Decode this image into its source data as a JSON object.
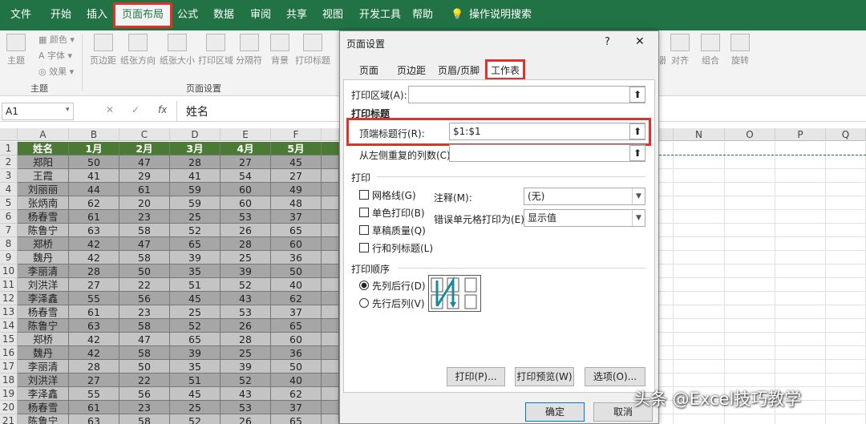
{
  "menu": [
    "文件",
    "开始",
    "插入",
    "页面布局",
    "公式",
    "数据",
    "审阅",
    "共享",
    "视图",
    "开发工具",
    "帮助",
    "操作说明搜索"
  ],
  "ribbon": {
    "theme_buttons": [
      "主题",
      "颜色",
      "字体",
      "效果"
    ],
    "pagesetup_buttons": [
      "页边距",
      "纸张方向",
      "纸张大小",
      "打印区域",
      "分隔符",
      "背景",
      "打印标题"
    ],
    "right_buttons": [
      "对齐",
      "组合",
      "旋转"
    ],
    "right_partial": "器",
    "group_labels": [
      "主题",
      "页面设置"
    ]
  },
  "namebox": "A1",
  "formula_value": "姓名",
  "fx": "fx",
  "columns": [
    "A",
    "B",
    "C",
    "D",
    "E",
    "F",
    "N",
    "O",
    "P",
    "Q"
  ],
  "rownums": [
    "1",
    "2",
    "3",
    "4",
    "5",
    "6",
    "7",
    "8",
    "9",
    "10",
    "11",
    "12",
    "13",
    "14",
    "15",
    "16",
    "17",
    "18",
    "19",
    "20",
    "21"
  ],
  "table": {
    "header": [
      "姓名",
      "1月",
      "2月",
      "3月",
      "4月",
      "5月"
    ],
    "rows": [
      [
        "郑阳",
        "50",
        "47",
        "28",
        "27",
        "45"
      ],
      [
        "王霞",
        "41",
        "29",
        "41",
        "54",
        "27"
      ],
      [
        "刘丽丽",
        "44",
        "61",
        "59",
        "60",
        "49"
      ],
      [
        "张炳南",
        "62",
        "20",
        "59",
        "60",
        "48"
      ],
      [
        "杨春雪",
        "61",
        "23",
        "25",
        "53",
        "37"
      ],
      [
        "陈鲁宁",
        "63",
        "58",
        "52",
        "26",
        "65"
      ],
      [
        "郑桥",
        "42",
        "47",
        "65",
        "28",
        "60"
      ],
      [
        "魏丹",
        "42",
        "58",
        "39",
        "25",
        "36"
      ],
      [
        "李丽清",
        "28",
        "50",
        "35",
        "39",
        "50"
      ],
      [
        "刘洪洋",
        "27",
        "22",
        "51",
        "52",
        "40"
      ],
      [
        "李泽鑫",
        "55",
        "56",
        "45",
        "43",
        "62"
      ],
      [
        "杨春雪",
        "61",
        "23",
        "25",
        "53",
        "37"
      ],
      [
        "陈鲁宁",
        "63",
        "58",
        "52",
        "26",
        "65"
      ],
      [
        "郑桥",
        "42",
        "47",
        "65",
        "28",
        "60"
      ],
      [
        "魏丹",
        "42",
        "58",
        "39",
        "25",
        "36"
      ],
      [
        "李丽清",
        "28",
        "50",
        "35",
        "39",
        "50"
      ],
      [
        "刘洪洋",
        "27",
        "22",
        "51",
        "52",
        "40"
      ],
      [
        "李泽鑫",
        "55",
        "56",
        "45",
        "43",
        "62"
      ],
      [
        "杨春雪",
        "61",
        "23",
        "25",
        "53",
        "37"
      ],
      [
        "陈鲁宁",
        "63",
        "58",
        "52",
        "26",
        "65"
      ]
    ]
  },
  "dialog": {
    "title": "页面设置",
    "help": "?",
    "close": "✕",
    "tabs": [
      "页面",
      "页边距",
      "页眉/页脚",
      "工作表"
    ],
    "print_area_label": "打印区域(A):",
    "print_titles_label": "打印标题",
    "top_rows_label": "顶端标题行(R):",
    "top_rows_value": "$1:$1",
    "left_cols_label": "从左侧重复的列数(C):",
    "print_section": "打印",
    "gridlines": "网格线(G)",
    "bw": "单色打印(B)",
    "draft": "草稿质量(Q)",
    "rowcol_headings": "行和列标题(L)",
    "comments_label": "注释(M):",
    "comments_value": "(无)",
    "errors_label": "错误单元格打印为(E):",
    "errors_value": "显示值",
    "order_section": "打印顺序",
    "order_down": "先列后行(D)",
    "order_over": "先行后列(V)",
    "btn_print": "打印(P)...",
    "btn_preview": "打印预览(W)",
    "btn_options": "选项(O)...",
    "btn_ok": "确定",
    "btn_cancel": "取消"
  },
  "watermark": "头条 @Excel技巧教学",
  "colors": {
    "excel_green": "#217346",
    "highlight_red": "#e0312b",
    "header_green": "#4b7a35"
  }
}
